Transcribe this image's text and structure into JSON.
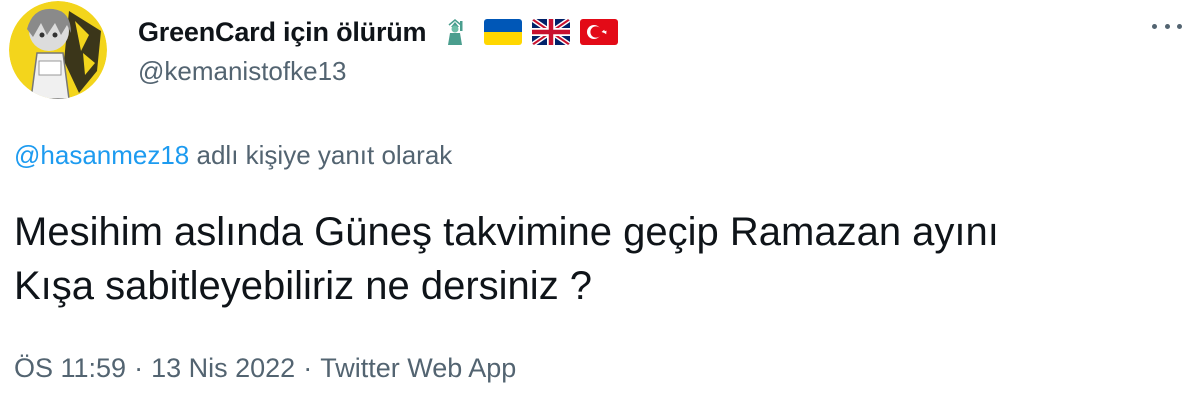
{
  "author": {
    "display_name": "GreenCard için ölürüm",
    "handle": "@kemanistofke13",
    "badges": [
      "statue-of-liberty-icon",
      "ukraine-flag-icon",
      "uk-flag-icon",
      "turkey-flag-icon"
    ]
  },
  "reply_context": {
    "mention": "@hasanmez18",
    "suffix": " adlı kişiye yanıt olarak"
  },
  "tweet": {
    "lines": [
      "Mesihim aslında Güneş takvimine geçip Ramazan ayını",
      "Kışa sabitleyebiliriz ne dersiniz ?"
    ]
  },
  "meta": {
    "time": "ÖS 11:59",
    "date": "13 Nis 2022",
    "source": "Twitter Web App",
    "separator": "·"
  },
  "colors": {
    "text": "#0f1419",
    "secondary": "#536471",
    "link": "#1d9bf0",
    "avatar_bg": "#f3d51c"
  }
}
